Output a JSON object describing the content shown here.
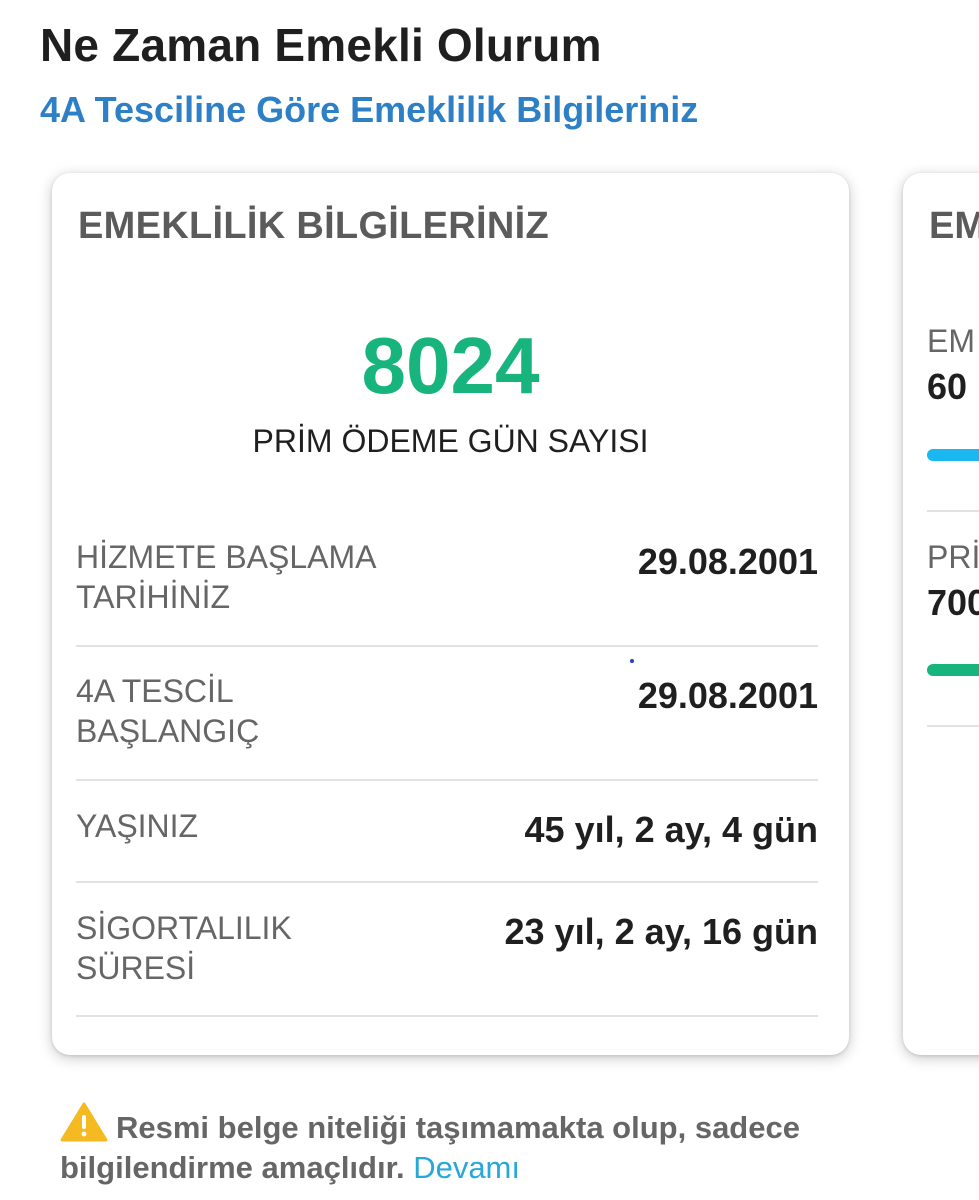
{
  "header": {
    "title": "Ne Zaman Emekli Olurum",
    "subtitle": "4A Tesciline Göre Emeklilik Bilgileriniz"
  },
  "card_main": {
    "heading": "EMEKLİLİK BİLGİLERİNİZ",
    "prim_count": "8024",
    "prim_caption": "PRİM ÖDEME GÜN SAYISI",
    "rows": [
      {
        "label": "HİZMETE BAŞLAMA\nTARİHİNİZ",
        "value": "29.08.2001"
      },
      {
        "label": "4A TESCİL\nBAŞLANGIÇ",
        "value": "29.08.2001"
      },
      {
        "label": "YAŞINIZ",
        "value": "45 yıl, 2 ay, 4 gün"
      },
      {
        "label": "SİGORTALILIK\nSÜRESİ",
        "value": "23 yıl, 2 ay, 16 gün"
      }
    ]
  },
  "card_second": {
    "heading": "EM",
    "items": [
      {
        "label": "EM",
        "value": "60",
        "bar_color": "#1ab7f0"
      },
      {
        "label": "PRİ",
        "value": "700",
        "bar_color": "#17b47e"
      }
    ]
  },
  "notice": {
    "text": "Resmi belge niteliği taşımamakta olup, sadece bilgilendirme amaçlıdır.",
    "link": "Devamı",
    "icon": "warning-icon",
    "icon_color": "#f5b921"
  }
}
